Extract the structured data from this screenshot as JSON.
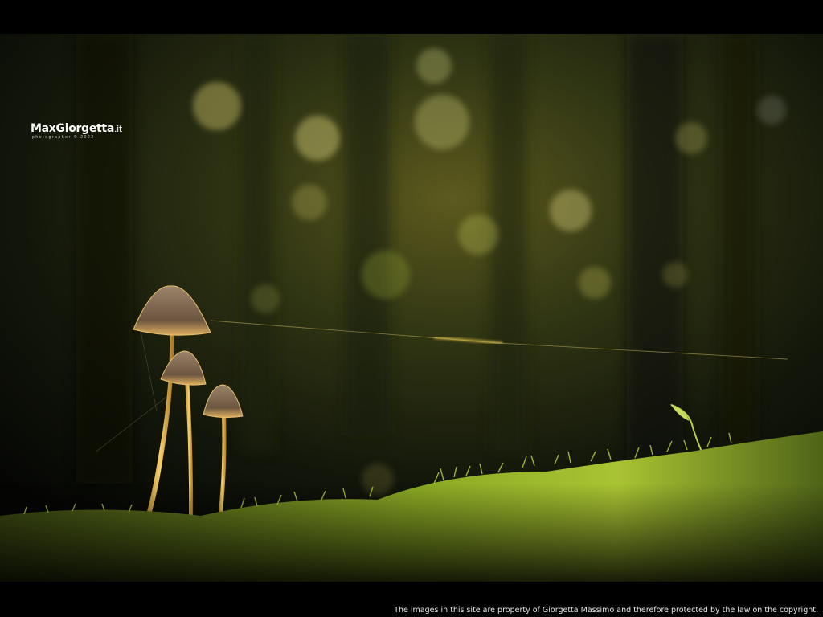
{
  "watermark": {
    "brand": "MaxGiorgetta",
    "tld": ".it",
    "tagline": "photographer © 2022"
  },
  "footer": {
    "copyright": "The images in this site are property of Giorgetta Massimo and therefore protected by the law on the copyright."
  },
  "colors": {
    "frame": "#000000",
    "moss": "#8fb12a",
    "bokeh": "#d8d27a",
    "mushroom_cap": "#8a7158",
    "mushroom_stem": "#e6b74a"
  }
}
